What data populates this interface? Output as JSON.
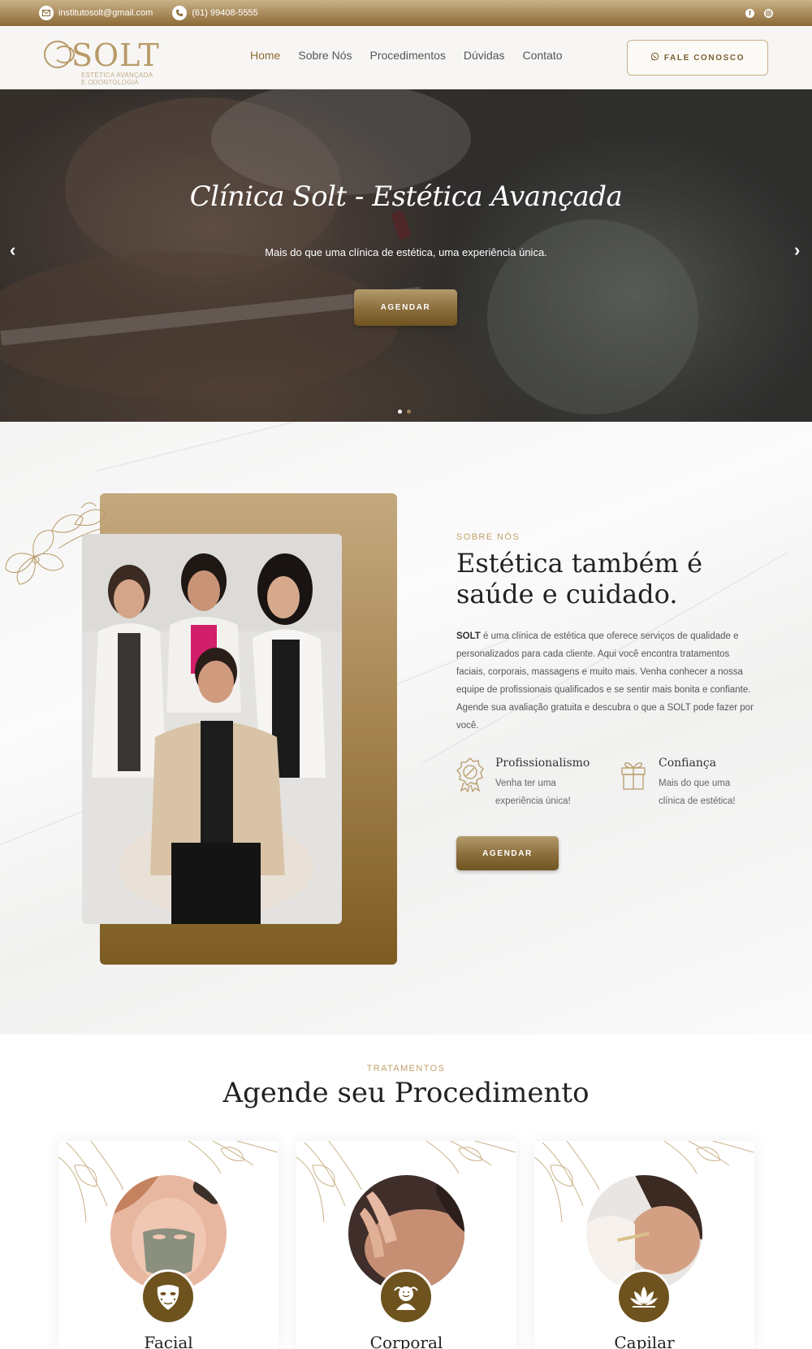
{
  "topbar": {
    "email": "institutosolt@gmail.com",
    "phone": "(61) 99408-5555",
    "social": [
      "facebook-icon",
      "instagram-icon"
    ]
  },
  "header": {
    "logo_text": "SOLT",
    "logo_sub_1": "ESTÉTICA AVANÇADA",
    "logo_sub_2": "E ODONTOLOGIA",
    "nav": [
      "Home",
      "Sobre Nós",
      "Procedimentos",
      "Dúvidas",
      "Contato"
    ],
    "active_nav": "Home",
    "cta": "FALE CONOSCO"
  },
  "hero": {
    "title": "Clínica Solt - Estética Avançada",
    "subtitle": "Mais do que uma clínica de estética, uma experiência única.",
    "button": "AGENDAR",
    "prev": "‹",
    "next": "›",
    "slide_count": 2,
    "active_slide": 1
  },
  "about": {
    "kicker": "SOBRE NÓS",
    "title": "Estética também é saúde e cuidado.",
    "desc_strong": "SOLT",
    "desc": " é uma clínica de estética que oferece serviços de qualidade e personalizados para cada cliente. Aqui você encontra tratamentos faciais, corporais, massagens e muito mais. Venha conhecer a nossa equipe de profissionais qualificados e se sentir mais bonita e confiante. Agende sua avaliação gratuita e descubra o que a SOLT pode fazer por você.",
    "features": [
      {
        "title": "Profissionalismo",
        "text": "Venha ter uma experiência única!",
        "icon": "award-badge-icon"
      },
      {
        "title": "Confiança",
        "text": "Mais do que uma clínica de estética!",
        "icon": "gift-box-icon"
      }
    ],
    "button": "AGENDAR"
  },
  "treatments": {
    "kicker": "TRATAMENTOS",
    "title": "Agende seu Procedimento",
    "cards": [
      {
        "title": "Facial",
        "icon": "face-mask-icon"
      },
      {
        "title": "Corporal",
        "icon": "body-massage-icon"
      },
      {
        "title": "Capilar",
        "icon": "lotus-icon"
      }
    ]
  },
  "colors": {
    "gold_dark": "#6e531f",
    "gold": "#a8895a",
    "gold_light": "#c9b287",
    "text_dark": "#222222"
  }
}
